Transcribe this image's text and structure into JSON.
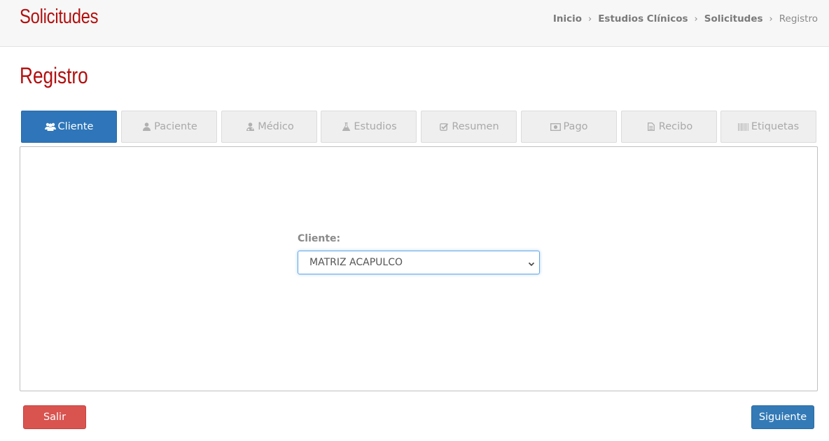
{
  "header": {
    "app_title": "Solicitudes",
    "breadcrumb": [
      {
        "label": "Inicio"
      },
      {
        "label": "Estudios Clínicos"
      },
      {
        "label": "Solicitudes"
      },
      {
        "label": "Registro"
      }
    ],
    "separator": "›"
  },
  "page": {
    "title": "Registro"
  },
  "tabs": [
    {
      "label": "Cliente",
      "icon": "users-icon",
      "active": true
    },
    {
      "label": "Paciente",
      "icon": "user-icon",
      "active": false
    },
    {
      "label": "Médico",
      "icon": "doctor-icon",
      "active": false
    },
    {
      "label": "Estudios",
      "icon": "flask-icon",
      "active": false
    },
    {
      "label": "Resumen",
      "icon": "check-square-icon",
      "active": false
    },
    {
      "label": "Pago",
      "icon": "money-icon",
      "active": false
    },
    {
      "label": "Recibo",
      "icon": "file-text-icon",
      "active": false
    },
    {
      "label": "Etiquetas",
      "icon": "barcode-icon",
      "active": false
    }
  ],
  "form": {
    "client_label": "Cliente:",
    "client_value": "MATRIZ ACAPULCO"
  },
  "footer": {
    "exit_label": "Salir",
    "next_label": "Siguiente"
  },
  "colors": {
    "brand_red": "#b30f0f",
    "primary_blue": "#337ab7",
    "danger_red": "#d9534f"
  }
}
